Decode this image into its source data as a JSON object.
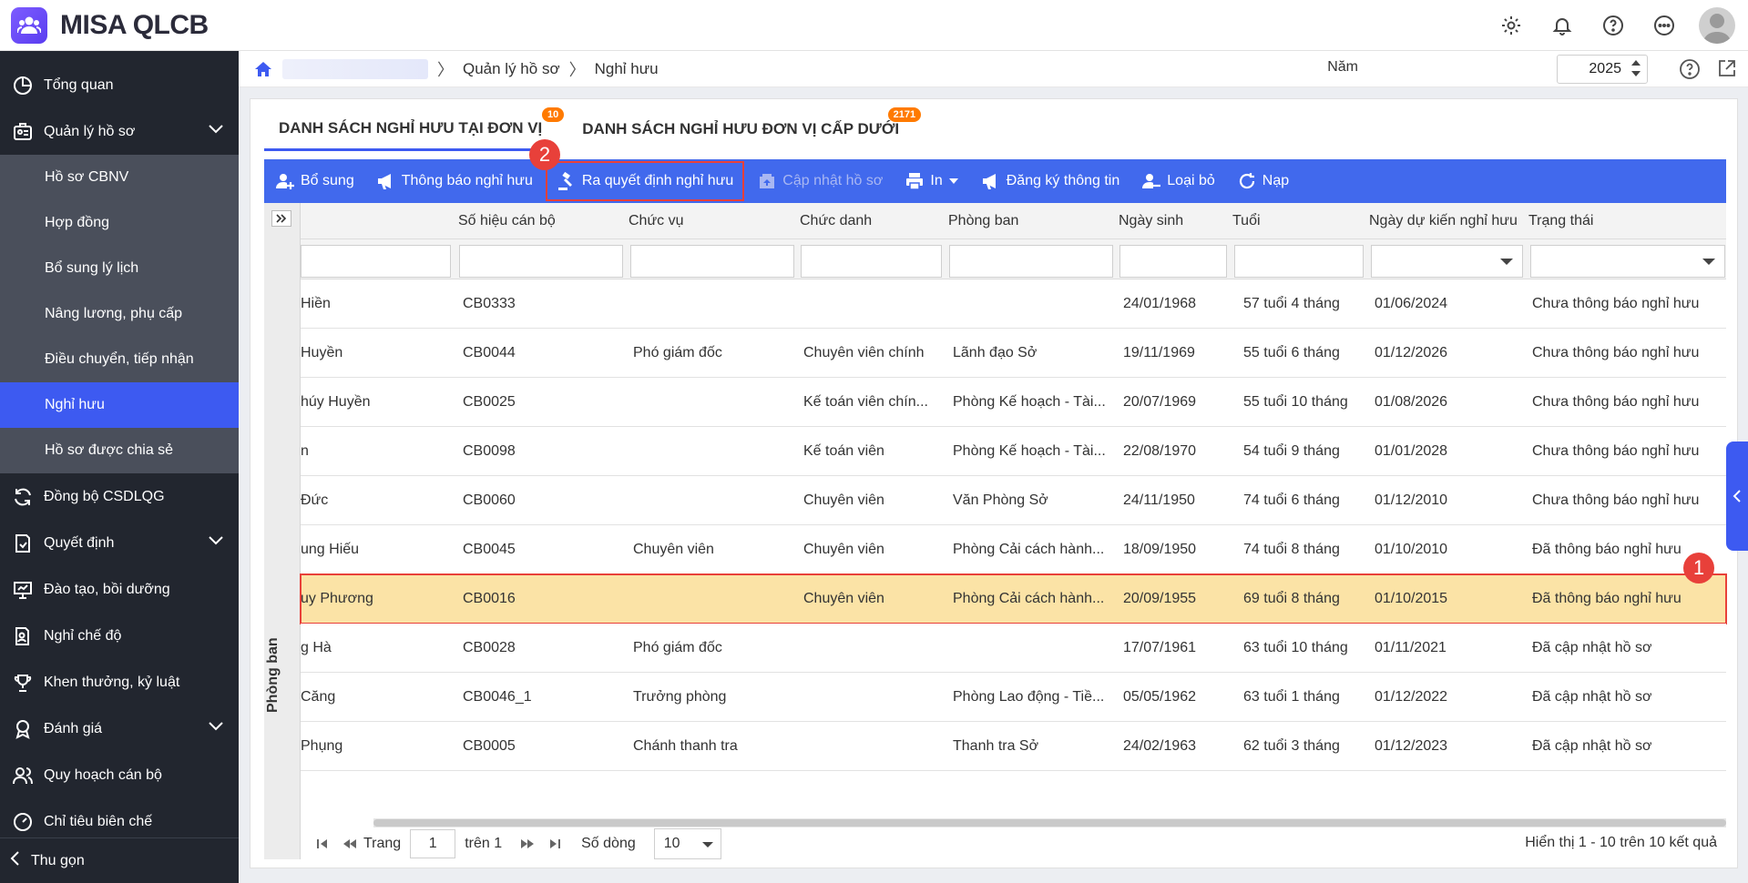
{
  "app": {
    "name": "MISA QLCB"
  },
  "sidebar": {
    "items": [
      {
        "label": "Tổng quan",
        "icon": "pie-chart-icon"
      },
      {
        "label": "Quản lý hồ sơ",
        "icon": "id-card-icon",
        "expanded": true
      },
      {
        "label": "Đồng bộ CSDLQG",
        "icon": "sync-icon"
      },
      {
        "label": "Quyết định",
        "icon": "document-check-icon",
        "expandable": true
      },
      {
        "label": "Đào tạo, bồi dưỡng",
        "icon": "presentation-icon"
      },
      {
        "label": "Nghỉ chế độ",
        "icon": "document-person-icon"
      },
      {
        "label": "Khen thưởng, kỷ luật",
        "icon": "trophy-icon"
      },
      {
        "label": "Đánh giá",
        "icon": "medal-icon",
        "expandable": true
      },
      {
        "label": "Quy hoạch cán bộ",
        "icon": "users-icon"
      },
      {
        "label": "Chỉ tiêu biên chế",
        "icon": "gauge-icon"
      }
    ],
    "sub_items": [
      "Hồ sơ CBNV",
      "Hợp đồng",
      "Bổ sung lý lịch",
      "Nâng lương, phụ cấp",
      "Điều chuyển, tiếp nhận",
      "Nghỉ hưu",
      "Hồ sơ được chia sẻ"
    ],
    "active_sub": "Nghỉ hưu",
    "collapse_label": "Thu gọn"
  },
  "breadcrumb": {
    "items": [
      "Quản lý hồ sơ",
      "Nghỉ hưu"
    ]
  },
  "year": {
    "label": "Năm",
    "value": "2025"
  },
  "tabs": [
    {
      "label": "DANH SÁCH NGHỈ HƯU TẠI ĐƠN VỊ",
      "badge": "10",
      "active": true
    },
    {
      "label": "DANH SÁCH NGHỈ HƯU ĐƠN VỊ CẤP DƯỚI",
      "badge": "2171",
      "active": false
    }
  ],
  "toolbar": [
    {
      "label": "Bổ sung",
      "icon": "add-user-icon"
    },
    {
      "label": "Thông báo nghỉ hưu",
      "icon": "megaphone-icon"
    },
    {
      "label": "Ra quyết định nghỉ hưu",
      "icon": "gavel-icon",
      "highlight": true
    },
    {
      "label": "Cập nhật hồ sơ",
      "icon": "update-icon",
      "disabled": true
    },
    {
      "label": "In",
      "icon": "printer-icon",
      "dropdown": true
    },
    {
      "label": "Đăng ký thông tin",
      "icon": "megaphone-icon"
    },
    {
      "label": "Loại bỏ",
      "icon": "remove-user-icon"
    },
    {
      "label": "Nạp",
      "icon": "refresh-icon"
    }
  ],
  "group_label": "Phòng ban",
  "columns": [
    "Số hiệu cán bộ",
    "Chức vụ",
    "Chức danh",
    "Phòng ban",
    "Ngày sinh",
    "Tuổi",
    "Ngày dự kiến nghỉ hưu",
    "Trạng thái"
  ],
  "rows": [
    {
      "name": "Hiền",
      "code": "CB0333",
      "position": "",
      "title": "",
      "dept": "",
      "dob": "24/01/1968",
      "age": "57 tuổi 4 tháng",
      "retire": "01/06/2024",
      "status": "Chưa thông báo nghỉ hưu"
    },
    {
      "name": "Huyền",
      "code": "CB0044",
      "position": "Phó giám đốc",
      "title": "Chuyên viên chính",
      "dept": "Lãnh đạo Sở",
      "dob": "19/11/1969",
      "age": "55 tuổi 6 tháng",
      "retire": "01/12/2026",
      "status": "Chưa thông báo nghỉ hưu"
    },
    {
      "name": "húy Huyền",
      "code": "CB0025",
      "position": "",
      "title": "Kế toán viên chín...",
      "dept": "Phòng Kế hoạch - Tài...",
      "dob": "20/07/1969",
      "age": "55 tuổi 10 tháng",
      "retire": "01/08/2026",
      "status": "Chưa thông báo nghỉ hưu"
    },
    {
      "name": "n",
      "code": "CB0098",
      "position": "",
      "title": "Kế toán viên",
      "dept": "Phòng Kế hoạch - Tài...",
      "dob": "22/08/1970",
      "age": "54 tuổi 9 tháng",
      "retire": "01/01/2028",
      "status": "Chưa thông báo nghỉ hưu"
    },
    {
      "name": "Đức",
      "code": "CB0060",
      "position": "",
      "title": "Chuyên viên",
      "dept": "Văn Phòng Sở",
      "dob": "24/11/1950",
      "age": "74 tuổi 6 tháng",
      "retire": "01/12/2010",
      "status": "Chưa thông báo nghỉ hưu"
    },
    {
      "name": "ung Hiếu",
      "code": "CB0045",
      "position": "Chuyên viên",
      "title": "Chuyên viên",
      "dept": "Phòng Cải cách hành...",
      "dob": "18/09/1950",
      "age": "74 tuổi 8 tháng",
      "retire": "01/10/2010",
      "status": "Đã thông báo nghỉ hưu"
    },
    {
      "name": "uy Phương",
      "code": "CB0016",
      "position": "",
      "title": "Chuyên viên",
      "dept": "Phòng Cải cách hành...",
      "dob": "20/09/1955",
      "age": "69 tuổi 8 tháng",
      "retire": "01/10/2015",
      "status": "Đã thông báo nghỉ hưu",
      "selected": true
    },
    {
      "name": "g Hà",
      "code": "CB0028",
      "position": "Phó giám đốc",
      "title": "",
      "dept": "",
      "dob": "17/07/1961",
      "age": "63 tuổi 10 tháng",
      "retire": "01/11/2021",
      "status": "Đã cập nhật hồ sơ"
    },
    {
      "name": "Căng",
      "code": "CB0046_1",
      "position": "Trưởng phòng",
      "title": "",
      "dept": "Phòng Lao động - Tiề...",
      "dob": "05/05/1962",
      "age": "63 tuổi 1 tháng",
      "retire": "01/12/2022",
      "status": "Đã cập nhật hồ sơ"
    },
    {
      "name": "Phụng",
      "code": "CB0005",
      "position": "Chánh thanh tra",
      "title": "",
      "dept": "Thanh tra Sở",
      "dob": "24/02/1963",
      "age": "62 tuổi 3 tháng",
      "retire": "01/12/2023",
      "status": "Đã cập nhật hồ sơ"
    }
  ],
  "pager": {
    "page_label": "Trang",
    "page": "1",
    "of_label": "trên 1",
    "rows_label": "Số dòng",
    "rows_value": "10",
    "summary": "Hiển thị 1 - 10 trên 10 kết quả"
  },
  "callouts": [
    "1",
    "2"
  ],
  "colors": {
    "accent": "#4169ed",
    "sidebar": "#22262f",
    "selected_row": "#fbe3a6",
    "badge": "#ff7a00",
    "callout": "#e8403a"
  }
}
